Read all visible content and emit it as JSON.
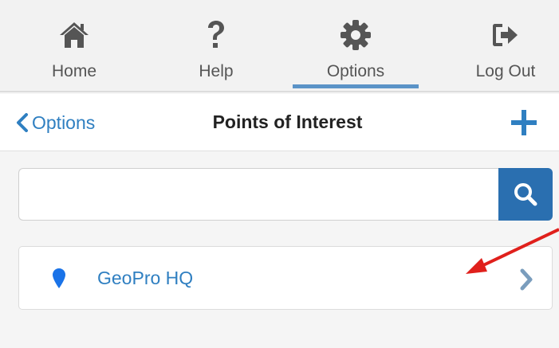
{
  "nav": {
    "items": [
      {
        "label": "Home",
        "icon": "home-icon"
      },
      {
        "label": "Help",
        "icon": "question-icon"
      },
      {
        "label": "Options",
        "icon": "gear-icon",
        "active": true
      },
      {
        "label": "Log Out",
        "icon": "logout-icon"
      }
    ]
  },
  "subheader": {
    "back_label": "Options",
    "title": "Points of Interest"
  },
  "search": {
    "value": "",
    "placeholder": ""
  },
  "poi_list": [
    {
      "name": "GeoPro HQ"
    }
  ],
  "colors": {
    "accent": "#2f7fc1",
    "search_button": "#2a6fb0",
    "active_tab_bar": "#5b93c7",
    "annotation_arrow": "#e0201c"
  }
}
